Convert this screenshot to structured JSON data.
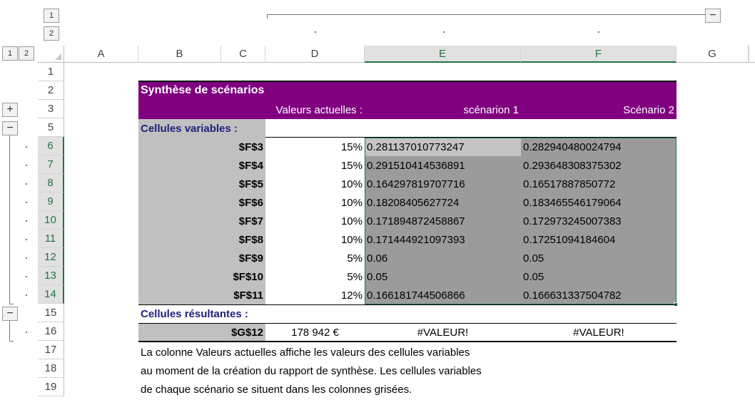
{
  "outline": {
    "col_levels": [
      "1",
      "2"
    ],
    "row_levels": [
      "1",
      "2"
    ],
    "col_collapse_symbol": "−",
    "row_group_symbols": {
      "expand_row3": "+",
      "collapse_row5": "−",
      "collapse_row15": "−"
    }
  },
  "columns": [
    "A",
    "B",
    "C",
    "D",
    "E",
    "F",
    "G"
  ],
  "rows": [
    "1",
    "2",
    "3",
    "5",
    "6",
    "7",
    "8",
    "9",
    "10",
    "11",
    "12",
    "13",
    "14",
    "15",
    "16",
    "17",
    "18",
    "19"
  ],
  "report": {
    "title": "Synthèse de scénarios",
    "header_current": "Valeurs actuelles :",
    "header_s1": "scénarion 1",
    "header_s2": "Scénario 2",
    "section_changing": "Cellules variables :",
    "section_result": "Cellules résultantes :",
    "changing_rows": [
      {
        "cell": "$F$3",
        "current": "15%",
        "s1": "0.281137010773247",
        "s2": "0.282940480024794"
      },
      {
        "cell": "$F$4",
        "current": "15%",
        "s1": "0.291510414536891",
        "s2": "0.293648308375302"
      },
      {
        "cell": "$F$5",
        "current": "10%",
        "s1": "0.164297819707716",
        "s2": "0.16517887850772"
      },
      {
        "cell": "$F$6",
        "current": "10%",
        "s1": "0.18208405627724",
        "s2": "0.183465546179064"
      },
      {
        "cell": "$F$7",
        "current": "10%",
        "s1": "0.171894872458867",
        "s2": "0.172973245007383"
      },
      {
        "cell": "$F$8",
        "current": "10%",
        "s1": "0.171444921097393",
        "s2": "0.17251094184604"
      },
      {
        "cell": "$F$9",
        "current": "5%",
        "s1": "0.06",
        "s2": "0.05"
      },
      {
        "cell": "$F$10",
        "current": "5%",
        "s1": "0.05",
        "s2": "0.05"
      },
      {
        "cell": "$F$11",
        "current": "12%",
        "s1": "0.166181744506866",
        "s2": "0.166631337504782"
      }
    ],
    "result_row": {
      "cell": "$G$12",
      "current": "178 942 €",
      "s1": "#VALEUR!",
      "s2": "#VALEUR!"
    },
    "notes": [
      "La colonne Valeurs actuelles affiche les valeurs des cellules variables",
      "au moment de la création du rapport de synthèse. Les cellules variables",
      "de chaque scénario se situent dans les colonnes grisées."
    ]
  },
  "colors": {
    "header_purple": "#800080",
    "gray_fill": "#c0c0c0",
    "selection_fill": "#9b9b9b",
    "active_cell": "#c4c4c4",
    "excel_green": "#217346",
    "section_text": "#1f1f7a"
  }
}
